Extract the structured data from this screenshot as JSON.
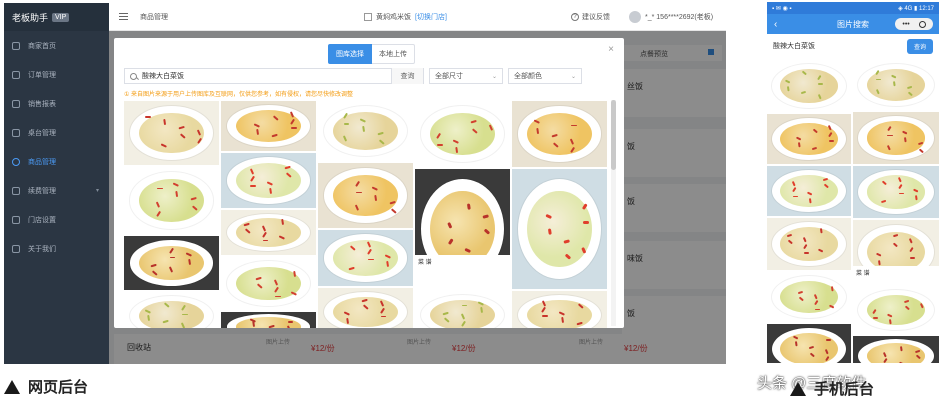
{
  "web": {
    "sidebar": {
      "logo": "老板助手",
      "vip": "VIP",
      "items": [
        {
          "label": "商家首页",
          "active": false
        },
        {
          "label": "订单管理",
          "active": false
        },
        {
          "label": "销售报表",
          "active": false
        },
        {
          "label": "桌台管理",
          "active": false
        },
        {
          "label": "商品管理",
          "active": true
        },
        {
          "label": "续费管理",
          "active": false,
          "caret": "▾"
        },
        {
          "label": "门店设置",
          "active": false
        },
        {
          "label": "关于我们",
          "active": false
        }
      ]
    },
    "topbar": {
      "crumb": "商品管理",
      "store": "黄焖鸡米饭",
      "switch": "[切换门店]",
      "feedback": "建议反馈",
      "user": "*_* 156****2692(老板)"
    },
    "background": {
      "preview_btn": "点餐预览",
      "dish_partials": [
        "丝饭",
        "饭",
        "饭",
        "味饭",
        "饭"
      ],
      "footer_items": [
        {
          "label": "图片上传",
          "price": "¥12/份"
        },
        {
          "label": "图片上传",
          "price": "¥12/份"
        },
        {
          "label": "图片上传",
          "price": "¥12/份"
        }
      ],
      "recycle": "回收站"
    },
    "modal": {
      "tabs": [
        "图库选择",
        "本地上传"
      ],
      "search_value": "酸辣大白菜饭",
      "search_btn": "查询",
      "size_select": "全部尺寸",
      "color_select": "全部颜色",
      "notice": "① 来自图片来源于用户上传图库及互联网，仅供您参考，如有侵权，请您尽快修改调整",
      "close": "×",
      "watermark_name": "菜 谱"
    }
  },
  "caption_web": "网页后台",
  "phone": {
    "status_left": "▪ ✉ ◉ ▪",
    "status_right": "◈ 4G ▮ 12:17",
    "title": "图片搜索",
    "back": "‹",
    "query": "酸辣大白菜饭",
    "search_btn": "查询",
    "watermark_name": "菜 谱"
  },
  "caption_phone": "手机后台",
  "watermark": "头条 @三度软件",
  "colors": {
    "sidebar_bg": "#2b3643",
    "primary": "#3a8ee6",
    "notice": "#f39c12",
    "price": "#e4393c"
  }
}
